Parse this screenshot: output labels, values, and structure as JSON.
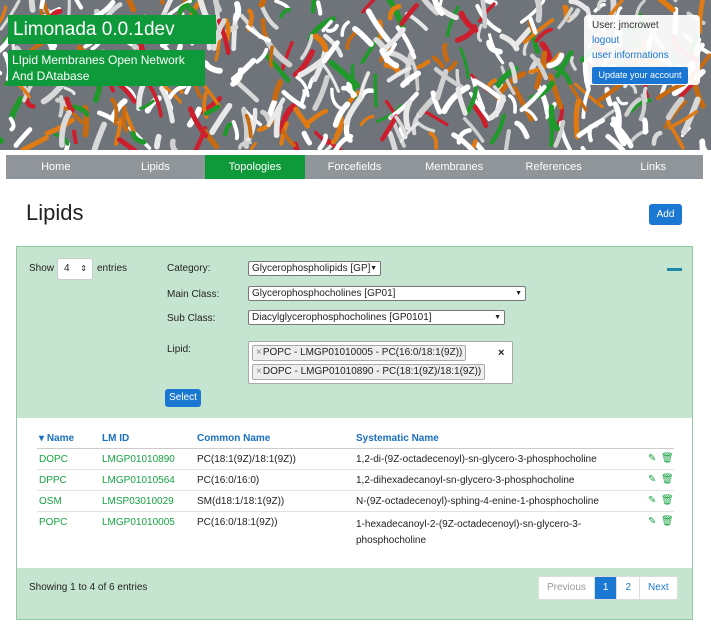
{
  "brand": {
    "title": "Limonada 0.0.1dev",
    "subtitle": "LIpid Membranes Open Network And DAtabase"
  },
  "user": {
    "name_label": "User: jmcrowet",
    "logout": "logout",
    "info": "user informations",
    "update_button": "Update your account"
  },
  "nav": {
    "items": [
      "Home",
      "Lipids",
      "Topologies",
      "Forcefields",
      "Membranes",
      "References",
      "Links"
    ],
    "active": "Topologies"
  },
  "page": {
    "title": "Lipids",
    "add_button": "Add"
  },
  "filters": {
    "show_label": "Show",
    "entries_value": "4",
    "entries_label": "entries",
    "category_label": "Category:",
    "category_value": "Glycerophospholipids [GP]",
    "main_class_label": "Main Class:",
    "main_class_value": "Glycerophosphocholines [GP01]",
    "sub_class_label": "Sub Class:",
    "sub_class_value": "Diacylglycerophosphocholines [GP0101]",
    "lipid_label": "Lipid:",
    "lipid_chips": [
      "POPC - LMGP01010005 - PC(16:0/18:1(9Z))",
      "DOPC - LMGP01010890 - PC(18:1(9Z)/18:1(9Z))"
    ],
    "clear_symbol": "×",
    "select_button": "Select"
  },
  "table": {
    "headers": [
      "Name",
      "LM ID",
      "Common Name",
      "Systematic Name"
    ],
    "rows": [
      {
        "name": "DOPC",
        "lmid": "LMGP01010890",
        "common": "PC(18:1(9Z)/18:1(9Z))",
        "systematic": "1,2-di-(9Z-octadecenoyl)-sn-glycero-3-phosphocholine"
      },
      {
        "name": "DPPC",
        "lmid": "LMGP01010564",
        "common": "PC(16:0/16:0)",
        "systematic": "1,2-dihexadecanoyl-sn-glycero-3-phosphocholine"
      },
      {
        "name": "OSM",
        "lmid": "LMSP03010029",
        "common": "SM(d18:1/18:1(9Z))",
        "systematic": "N-(9Z-octadecenoyl)-sphing-4-enine-1-phosphocholine"
      },
      {
        "name": "POPC",
        "lmid": "LMGP01010005",
        "common": "PC(16:0/18:1(9Z))",
        "systematic": "1-hexadecanoyl-2-(9Z-octadecenoyl)-sn-glycero-3-phosphocholine"
      }
    ]
  },
  "footer": {
    "showing": "Showing 1 to 4 of 6 entries",
    "pagination": [
      "Previous",
      "1",
      "2",
      "Next"
    ],
    "current_page": "1"
  },
  "colors": {
    "brand_green": "#0e9a3a",
    "link_blue": "#1a78d2",
    "panel_green": "#c6e5d0",
    "nav_gray": "#8f9599"
  },
  "icons": {
    "sort": "sort-caret-icon",
    "edit": "pencil-icon",
    "delete": "trash-icon",
    "collapse": "minus-icon"
  }
}
